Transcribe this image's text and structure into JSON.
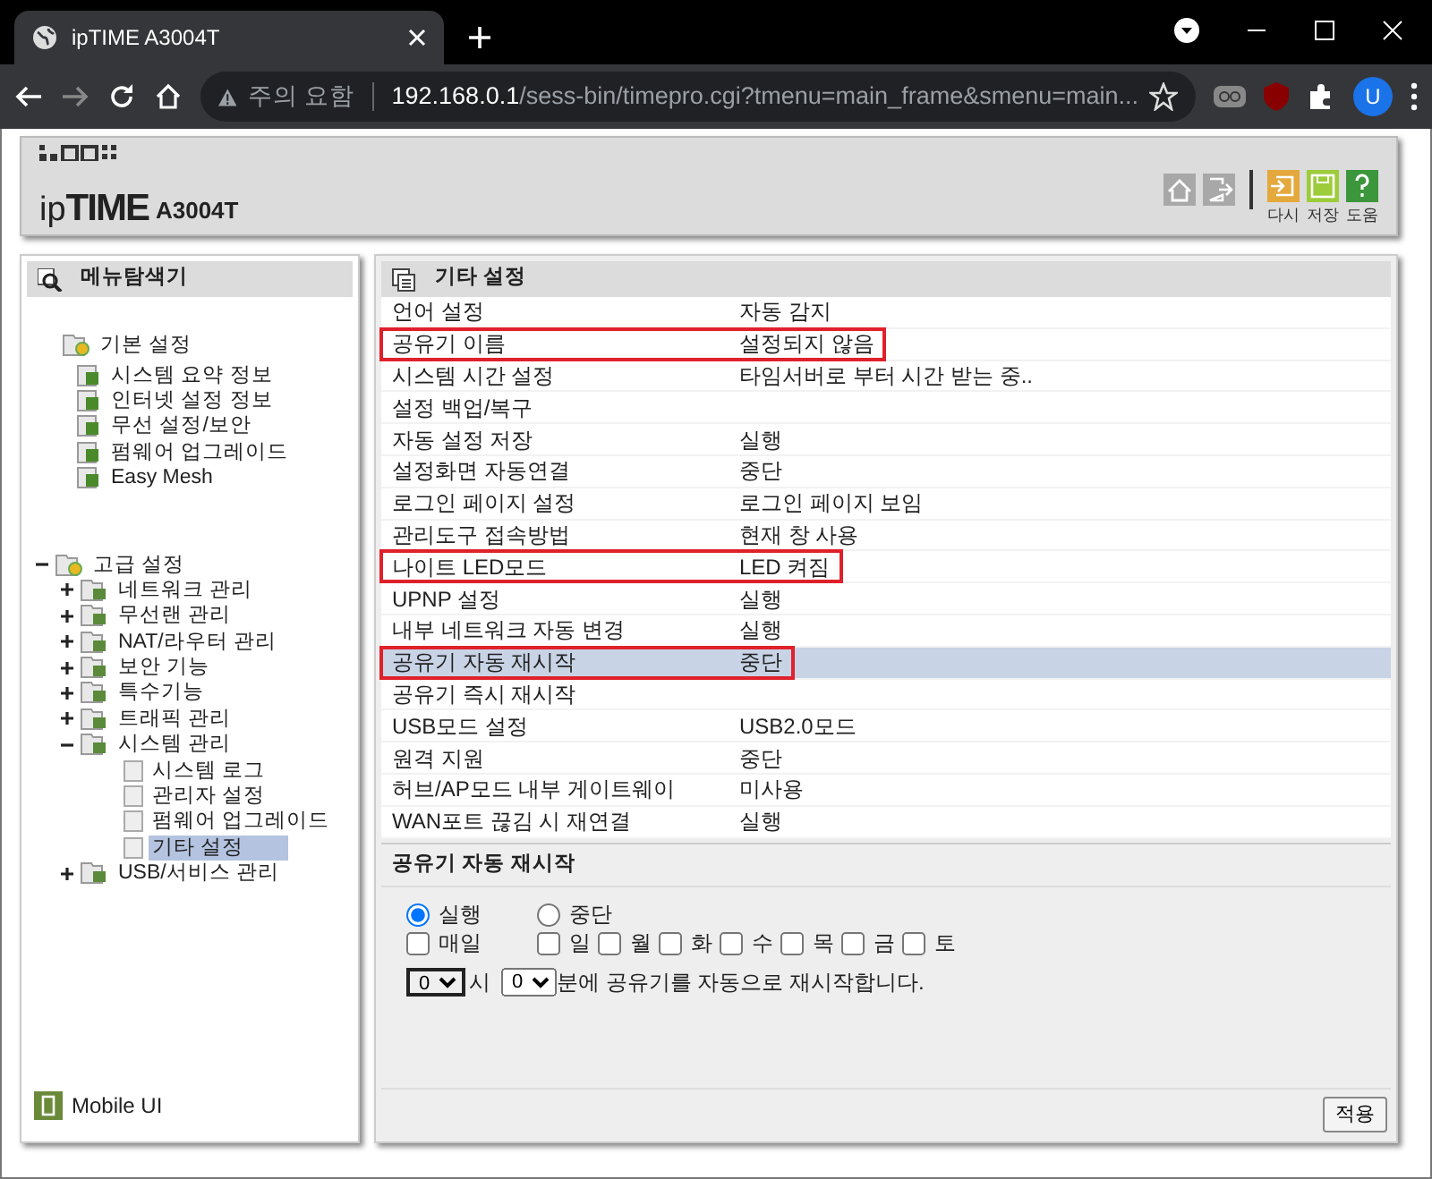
{
  "browser": {
    "tab_title": "ipTIME A3004T",
    "security_label": "주의 요함",
    "url_host": "192.168.0.1",
    "url_path": "/sess-bin/timepro.cgi?tmenu=main_frame&smenu=main...",
    "profile_initial": "U"
  },
  "header": {
    "logo_prefix": "ip",
    "logo_brand": "TIME",
    "model": "A3004T",
    "actions": [
      {
        "kind": "home"
      },
      {
        "kind": "logout"
      },
      {
        "kind": "reload",
        "label": "다시",
        "color": "#e4a83c"
      },
      {
        "kind": "save",
        "label": "저장",
        "color": "#9ccc3a"
      },
      {
        "kind": "help",
        "label": "도움",
        "color": "#3c963c"
      }
    ]
  },
  "navigator": {
    "title": "메뉴탐색기",
    "tree": [
      {
        "label": "기본 설정",
        "kind": "folder",
        "selected": false,
        "children": [
          {
            "label": "시스템 요약 정보",
            "kind": "page",
            "selected": false
          },
          {
            "label": "인터넷 설정 정보",
            "kind": "page",
            "selected": false
          },
          {
            "label": "무선 설정/보안",
            "kind": "page",
            "selected": false
          },
          {
            "label": "펌웨어 업그레이드",
            "kind": "page",
            "selected": false
          },
          {
            "label": "Easy Mesh",
            "kind": "page",
            "selected": false
          }
        ]
      },
      {
        "label": "고급 설정",
        "kind": "folder",
        "expanded": true,
        "selected": false,
        "children": [
          {
            "label": "네트워크 관리",
            "kind": "folder",
            "expanded": false,
            "selected": false
          },
          {
            "label": "무선랜 관리",
            "kind": "folder",
            "expanded": false,
            "selected": false
          },
          {
            "label": "NAT/라우터 관리",
            "kind": "folder",
            "expanded": false,
            "selected": false
          },
          {
            "label": "보안 기능",
            "kind": "folder",
            "expanded": false,
            "selected": false
          },
          {
            "label": "특수기능",
            "kind": "folder",
            "expanded": false,
            "selected": false
          },
          {
            "label": "트래픽 관리",
            "kind": "folder",
            "expanded": false,
            "selected": false
          },
          {
            "label": "시스템 관리",
            "kind": "folder",
            "expanded": true,
            "selected": false,
            "children": [
              {
                "label": "시스템 로그",
                "kind": "leaf",
                "selected": false
              },
              {
                "label": "관리자 설정",
                "kind": "leaf",
                "selected": false
              },
              {
                "label": "펌웨어 업그레이드",
                "kind": "leaf",
                "selected": false
              },
              {
                "label": "기타 설정",
                "kind": "leaf",
                "selected": true
              }
            ]
          },
          {
            "label": "USB/서비스 관리",
            "kind": "folder",
            "expanded": false,
            "selected": false
          }
        ]
      }
    ],
    "mobile_link": "Mobile UI"
  },
  "settings": {
    "title": "기타 설정",
    "rows": [
      {
        "label": "언어 설정",
        "value": "자동 감지",
        "highlighted": false,
        "selected": false
      },
      {
        "label": "공유기 이름",
        "value": "설정되지 않음",
        "highlighted": true,
        "selected": false
      },
      {
        "label": "시스템 시간 설정",
        "value": "타임서버로 부터 시간 받는 중..",
        "highlighted": false,
        "selected": false
      },
      {
        "label": "설정 백업/복구",
        "highlighted": false,
        "selected": false
      },
      {
        "label": "자동 설정 저장",
        "value": "실행",
        "highlighted": false,
        "selected": false
      },
      {
        "label": "설정화면 자동연결",
        "value": "중단",
        "highlighted": false,
        "selected": false
      },
      {
        "label": "로그인 페이지 설정",
        "value": "로그인 페이지 보임",
        "highlighted": false,
        "selected": false
      },
      {
        "label": "관리도구 접속방법",
        "value": "현재 창 사용",
        "highlighted": false,
        "selected": false
      },
      {
        "label": "나이트 LED모드",
        "value": "LED 켜짐",
        "highlighted": true,
        "selected": false
      },
      {
        "label": "UPNP 설정",
        "value": "실행",
        "highlighted": false,
        "selected": false
      },
      {
        "label": "내부 네트워크 자동 변경",
        "value": "실행",
        "highlighted": false,
        "selected": false
      },
      {
        "label": "공유기 자동 재시작",
        "value": "중단",
        "highlighted": true,
        "selected": true
      },
      {
        "label": "공유기 즉시 재시작",
        "highlighted": false,
        "selected": false
      },
      {
        "label": "USB모드 설정",
        "value": "USB2.0모드",
        "highlighted": false,
        "selected": false
      },
      {
        "label": "원격 지원",
        "value": "중단",
        "highlighted": false,
        "selected": false
      },
      {
        "label": "허브/AP모드 내부 게이트웨이",
        "value": "미사용",
        "highlighted": false,
        "selected": false
      },
      {
        "label": "WAN포트 끊김 시 재연결",
        "value": "실행",
        "highlighted": false,
        "selected": false
      }
    ]
  },
  "auto_restart": {
    "title": "공유기 자동 재시작",
    "modes": [
      {
        "label": "실행",
        "selected": true
      },
      {
        "label": "중단",
        "selected": false
      }
    ],
    "everyday": {
      "label": "매일",
      "checked": false
    },
    "days": [
      {
        "label": "일",
        "checked": false
      },
      {
        "label": "월",
        "checked": false
      },
      {
        "label": "화",
        "checked": false
      },
      {
        "label": "수",
        "checked": false
      },
      {
        "label": "목",
        "checked": false
      },
      {
        "label": "금",
        "checked": false
      },
      {
        "label": "토",
        "checked": false
      }
    ],
    "hour": "0",
    "hour_unit": "시",
    "minute": "0",
    "sentence": "분에 공유기를 자동으로 재시작합니다.",
    "apply": "적용"
  }
}
